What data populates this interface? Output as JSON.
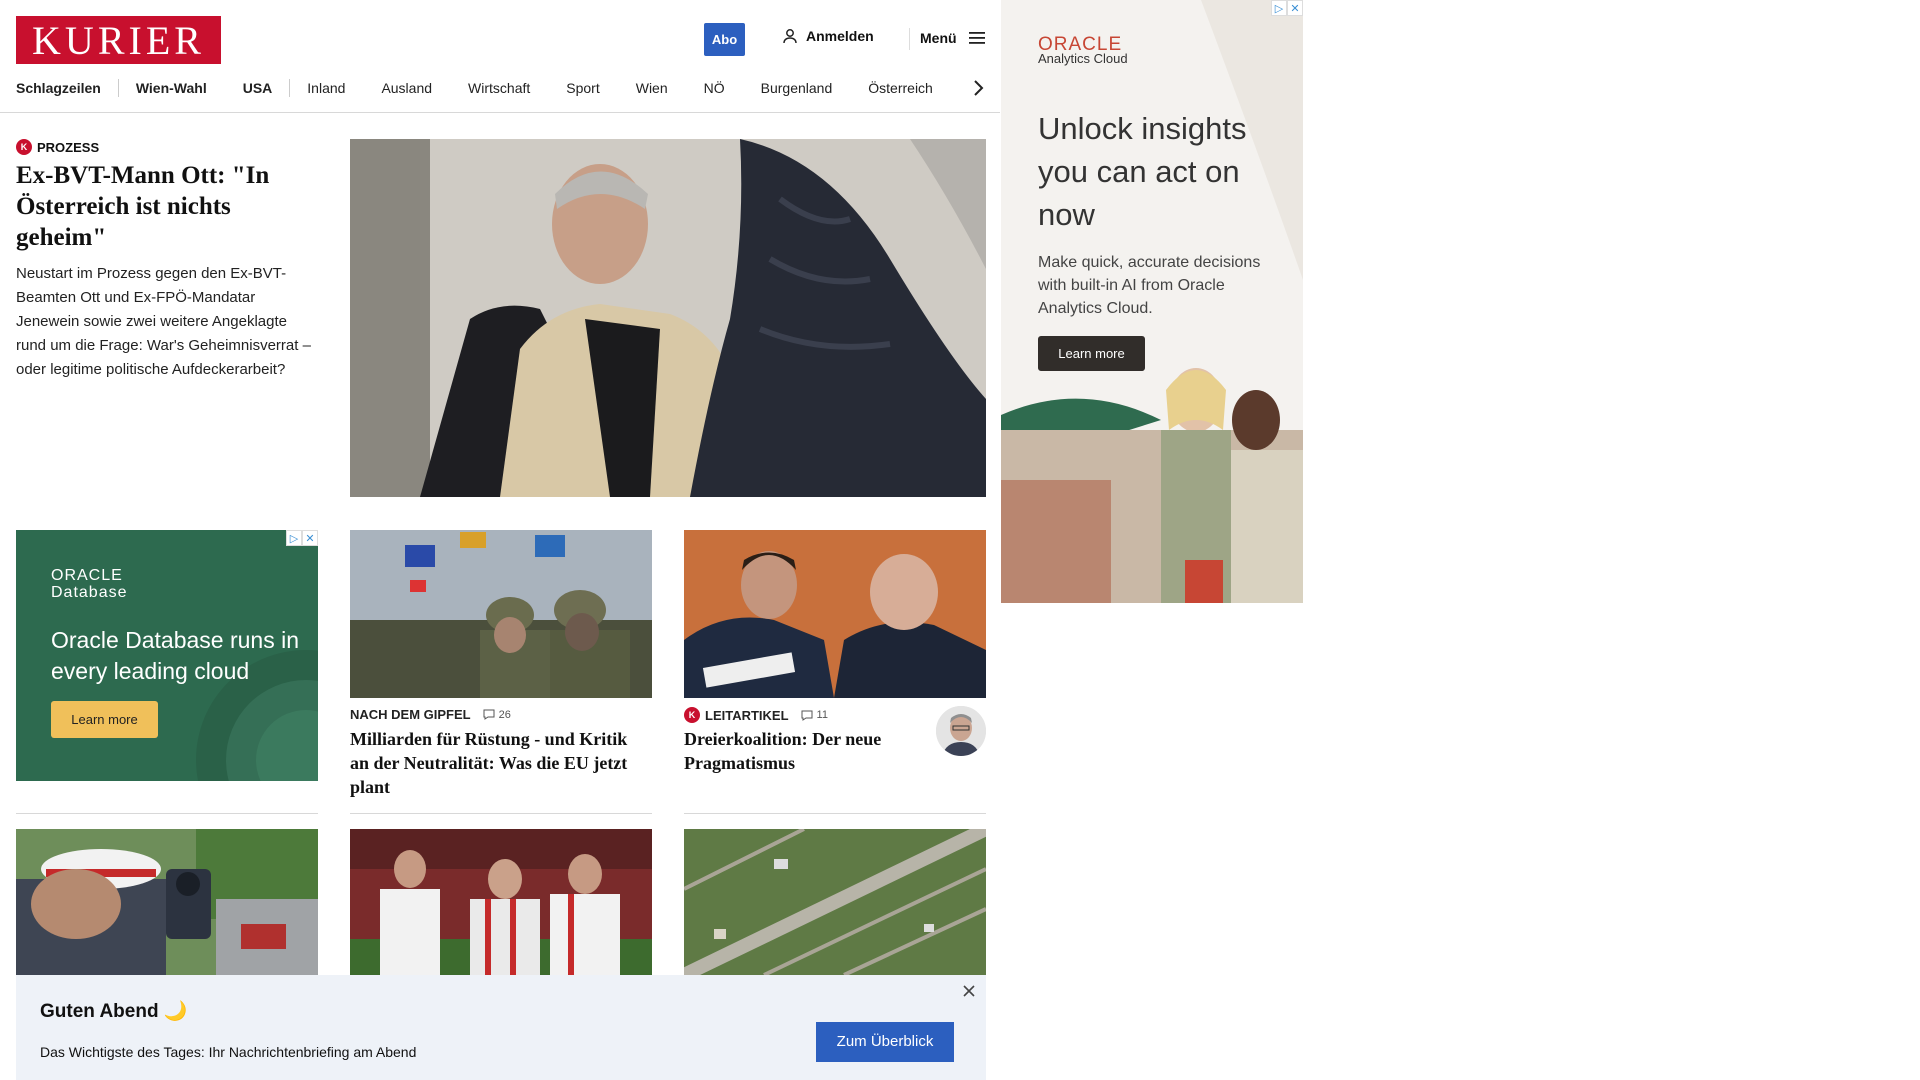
{
  "header": {
    "logo": "KURIER",
    "abo_label": "Abo",
    "login_label": "Anmelden",
    "menu_label": "Menü",
    "nav": [
      "Schlagzeilen",
      "Wien-Wahl",
      "USA",
      "Inland",
      "Ausland",
      "Wirtschaft",
      "Sport",
      "Wien",
      "NÖ",
      "Burgenland",
      "Österreich"
    ]
  },
  "lead": {
    "kicker": "PROZESS",
    "k_mark": "K",
    "title": "Ex-BVT-Mann Ott: \"In Österreich ist nichts geheim\"",
    "teaser": "Neustart im Prozess gegen den Ex-BVT-Beamten Ott und Ex-FPÖ-Mandatar Jenewein sowie zwei weitere Angeklagte rund um die Frage: War's Geheimnisverrat – oder legitime politische Aufdeckerarbeit?"
  },
  "ad_small": {
    "brand_line1": "ORACLE",
    "brand_line2": "Database",
    "headline": "Oracle Database runs in every leading cloud",
    "button": "Learn more",
    "adchoice_play": "▷",
    "adchoice_close": "✕"
  },
  "cards": [
    {
      "kicker": "NACH DEM GIPFEL",
      "comments": "26",
      "title": "Milliarden für Rüstung - und Kritik an der Neutralität: Was die EU jetzt plant"
    },
    {
      "kicker": "LEITARTIKEL",
      "k_mark": "K",
      "comments": "11",
      "title": "Dreierkoalition: Der neue Pragmatismus"
    }
  ],
  "ad_big": {
    "brand": "ORACLE",
    "sub": "Analytics Cloud",
    "headline": "Unlock insights you can act on now",
    "body": "Make quick, accurate decisions with built-in AI from Oracle Analytics Cloud.",
    "button": "Learn more",
    "adchoice_play": "▷",
    "adchoice_close": "✕"
  },
  "briefing": {
    "title": "Guten Abend 🌙",
    "text": "Das Wichtigste des Tages: Ihr Nachrichtenbriefing am Abend",
    "button": "Zum Überblick"
  },
  "colors": {
    "brand_red": "#c8102e",
    "accent_blue": "#2c5fbf",
    "oracle_green": "#2d6a4f",
    "oracle_red": "#c74634"
  }
}
